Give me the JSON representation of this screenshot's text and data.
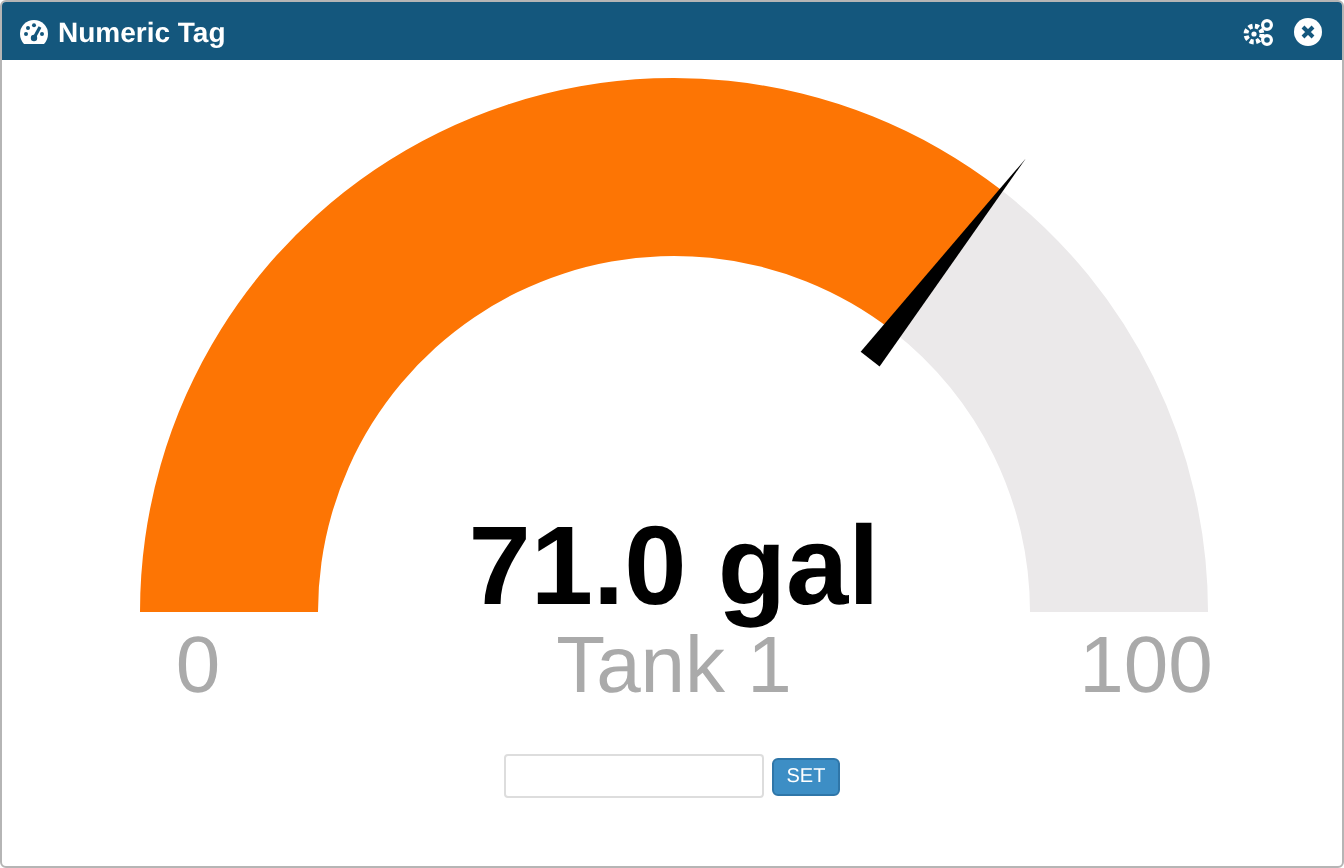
{
  "window": {
    "title": "Numeric Tag"
  },
  "gauge": {
    "value": "71.0 gal",
    "label": "Tank 1",
    "min": "0",
    "max": "100"
  },
  "set_button": "SET"
}
